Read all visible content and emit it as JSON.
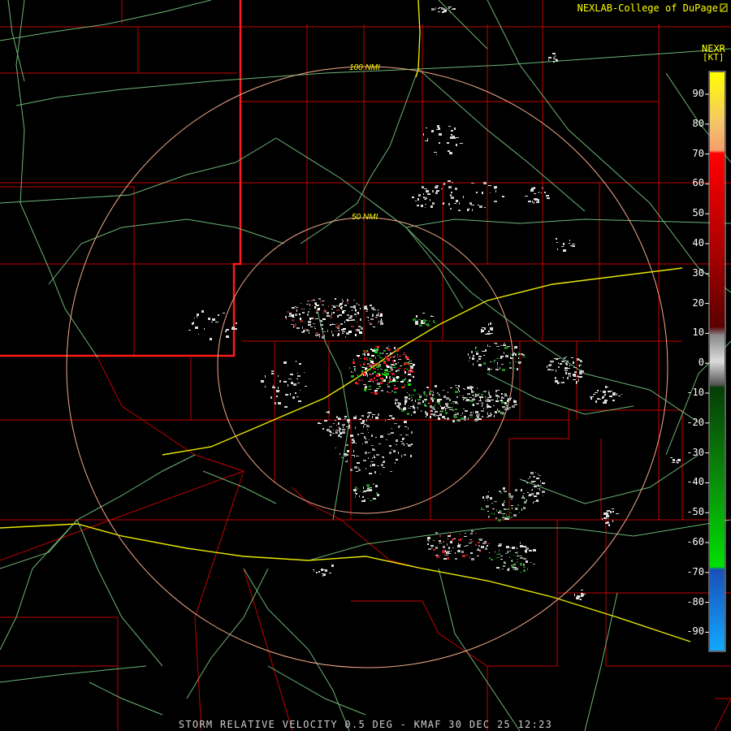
{
  "header": {
    "credit": "NEXLAB-College of DuPage",
    "credit_icon": "logo-mark-icon",
    "product": "NEXR",
    "units": "[KT]"
  },
  "range_rings": {
    "inner_label": "50 NMI",
    "outer_label": "100 NMI"
  },
  "legend": {
    "ticks": [
      "90",
      "80",
      "70",
      "60",
      "50",
      "40",
      "30",
      "20",
      "10",
      "0",
      "-10",
      "-20",
      "-30",
      "-40",
      "-50",
      "-60",
      "-70",
      "-80",
      "-90"
    ],
    "colors": {
      "top": "#ffff00",
      "orange": "#f59d6b",
      "red": "#ff0000",
      "darkred": "#6b0000",
      "gray": "#9a9a9a",
      "darkgreen": "#0a6b0a",
      "green": "#00e000",
      "blue": "#1a5fd1",
      "lightblue": "#12a8ff"
    }
  },
  "footer": {
    "caption": "STORM RELATIVE VELOCITY 0.5 DEG - KMAF 30 DEC 25 12:23"
  },
  "colors": {
    "background": "#000000",
    "county_lines": "#c40000",
    "state_line": "#ff1a1a",
    "highways": "#7fd68a",
    "interstates": "#e8e800",
    "range_rings": "#f3a98a",
    "label_text": "#ffff00"
  }
}
